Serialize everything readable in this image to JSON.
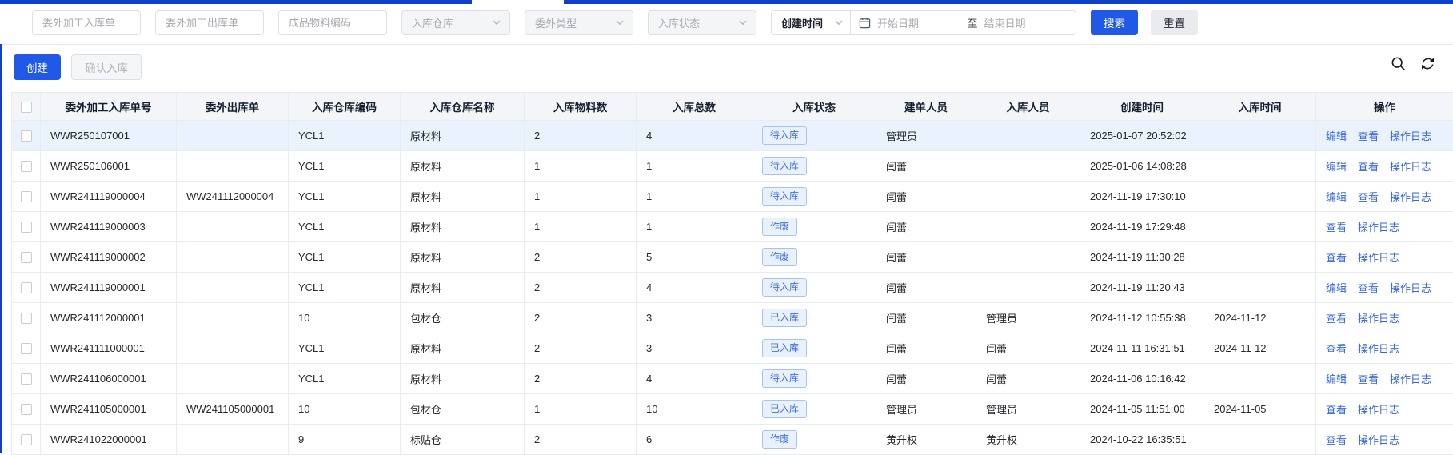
{
  "filters": {
    "text_inputs": [
      {
        "placeholder": "委外加工入库单"
      },
      {
        "placeholder": "委外加工出库单"
      },
      {
        "placeholder": "成品物料编码"
      }
    ],
    "selects": [
      {
        "placeholder": "入库仓库"
      },
      {
        "placeholder": "委外类型"
      },
      {
        "placeholder": "入库状态"
      }
    ],
    "date_filter": {
      "type_selected": "创建时间",
      "start_placeholder": "开始日期",
      "separator": "至",
      "end_placeholder": "结束日期"
    },
    "search_button": "搜索",
    "reset_button": "重置"
  },
  "toolbar": {
    "create_button": "创建",
    "confirm_inbound_button": "确认入库",
    "icons": [
      "search-icon",
      "refresh-icon"
    ]
  },
  "table": {
    "columns": [
      {
        "key": "order_no",
        "label": "委外加工入库单号"
      },
      {
        "key": "outbound_no",
        "label": "委外出库单"
      },
      {
        "key": "warehouse_code",
        "label": "入库仓库编码"
      },
      {
        "key": "warehouse_name",
        "label": "入库仓库名称"
      },
      {
        "key": "material_count",
        "label": "入库物料数"
      },
      {
        "key": "total_count",
        "label": "入库总数"
      },
      {
        "key": "status",
        "label": "入库状态"
      },
      {
        "key": "creator",
        "label": "建单人员"
      },
      {
        "key": "inbound_operator",
        "label": "入库人员"
      },
      {
        "key": "created_at",
        "label": "创建时间"
      },
      {
        "key": "inbound_at",
        "label": "入库时间"
      },
      {
        "key": "actions",
        "label": "操作"
      }
    ],
    "rows": [
      {
        "order_no": "WWR250107001",
        "outbound_no": "",
        "warehouse_code": "YCL1",
        "warehouse_name": "原材料",
        "material_count": "2",
        "total_count": "4",
        "status": "待入库",
        "creator": "管理员",
        "inbound_operator": "",
        "created_at": "2025-01-07 20:52:02",
        "inbound_at": "",
        "actions": [
          "编辑",
          "查看",
          "操作日志"
        ],
        "highlighted": true
      },
      {
        "order_no": "WWR250106001",
        "outbound_no": "",
        "warehouse_code": "YCL1",
        "warehouse_name": "原材料",
        "material_count": "1",
        "total_count": "1",
        "status": "待入库",
        "creator": "闫蕾",
        "inbound_operator": "",
        "created_at": "2025-01-06 14:08:28",
        "inbound_at": "",
        "actions": [
          "编辑",
          "查看",
          "操作日志"
        ],
        "highlighted": false
      },
      {
        "order_no": "WWR241119000004",
        "outbound_no": "WW241112000004",
        "warehouse_code": "YCL1",
        "warehouse_name": "原材料",
        "material_count": "1",
        "total_count": "1",
        "status": "待入库",
        "creator": "闫蕾",
        "inbound_operator": "",
        "created_at": "2024-11-19 17:30:10",
        "inbound_at": "",
        "actions": [
          "编辑",
          "查看",
          "操作日志"
        ],
        "highlighted": false
      },
      {
        "order_no": "WWR241119000003",
        "outbound_no": "",
        "warehouse_code": "YCL1",
        "warehouse_name": "原材料",
        "material_count": "1",
        "total_count": "1",
        "status": "作废",
        "creator": "闫蕾",
        "inbound_operator": "",
        "created_at": "2024-11-19 17:29:48",
        "inbound_at": "",
        "actions": [
          "查看",
          "操作日志"
        ],
        "highlighted": false
      },
      {
        "order_no": "WWR241119000002",
        "outbound_no": "",
        "warehouse_code": "YCL1",
        "warehouse_name": "原材料",
        "material_count": "2",
        "total_count": "5",
        "status": "作废",
        "creator": "闫蕾",
        "inbound_operator": "",
        "created_at": "2024-11-19 11:30:28",
        "inbound_at": "",
        "actions": [
          "查看",
          "操作日志"
        ],
        "highlighted": false
      },
      {
        "order_no": "WWR241119000001",
        "outbound_no": "",
        "warehouse_code": "YCL1",
        "warehouse_name": "原材料",
        "material_count": "2",
        "total_count": "4",
        "status": "待入库",
        "creator": "闫蕾",
        "inbound_operator": "",
        "created_at": "2024-11-19 11:20:43",
        "inbound_at": "",
        "actions": [
          "编辑",
          "查看",
          "操作日志"
        ],
        "highlighted": false
      },
      {
        "order_no": "WWR241112000001",
        "outbound_no": "",
        "warehouse_code": "10",
        "warehouse_name": "包材仓",
        "material_count": "2",
        "total_count": "3",
        "status": "已入库",
        "creator": "闫蕾",
        "inbound_operator": "管理员",
        "created_at": "2024-11-12 10:55:38",
        "inbound_at": "2024-11-12",
        "actions": [
          "查看",
          "操作日志"
        ],
        "highlighted": false
      },
      {
        "order_no": "WWR241111000001",
        "outbound_no": "",
        "warehouse_code": "YCL1",
        "warehouse_name": "原材料",
        "material_count": "2",
        "total_count": "3",
        "status": "已入库",
        "creator": "闫蕾",
        "inbound_operator": "闫蕾",
        "created_at": "2024-11-11 16:31:51",
        "inbound_at": "2024-11-12",
        "actions": [
          "查看",
          "操作日志"
        ],
        "highlighted": false
      },
      {
        "order_no": "WWR241106000001",
        "outbound_no": "",
        "warehouse_code": "YCL1",
        "warehouse_name": "原材料",
        "material_count": "2",
        "total_count": "4",
        "status": "待入库",
        "creator": "闫蕾",
        "inbound_operator": "闫蕾",
        "created_at": "2024-11-06 10:16:42",
        "inbound_at": "",
        "actions": [
          "编辑",
          "查看",
          "操作日志"
        ],
        "highlighted": false
      },
      {
        "order_no": "WWR241105000001",
        "outbound_no": "WW241105000001",
        "warehouse_code": "10",
        "warehouse_name": "包材仓",
        "material_count": "1",
        "total_count": "10",
        "status": "已入库",
        "creator": "管理员",
        "inbound_operator": "管理员",
        "created_at": "2024-11-05 11:51:00",
        "inbound_at": "2024-11-05",
        "actions": [
          "查看",
          "操作日志"
        ],
        "highlighted": false
      },
      {
        "order_no": "WWR241022000001",
        "outbound_no": "",
        "warehouse_code": "9",
        "warehouse_name": "标贴仓",
        "material_count": "2",
        "total_count": "6",
        "status": "作废",
        "creator": "黄升权",
        "inbound_operator": "黄升权",
        "created_at": "2024-10-22 16:35:51",
        "inbound_at": "",
        "actions": [
          "查看",
          "操作日志"
        ],
        "highlighted": false
      }
    ]
  },
  "colors": {
    "primary": "#2059e6",
    "top_bar": "#0e41c8",
    "link": "#3667e0",
    "status_badge_text": "#3e6fe2",
    "status_badge_bg": "#e9f1fd",
    "status_badge_border": "#a7c3f2",
    "row_highlight": "#eaf2fd"
  }
}
